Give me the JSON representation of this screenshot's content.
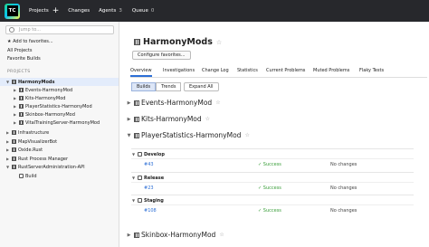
{
  "topbar": {
    "logo": "TC",
    "projects_label": "Projects",
    "changes_label": "Changes",
    "agents_label": "Agents",
    "agents_count": "3",
    "queue_label": "Queue",
    "queue_count": "0"
  },
  "sidebar": {
    "search_placeholder": "Jump to...",
    "add_favorites": "★ Add to favorites...",
    "all_projects": "All Projects",
    "favorite_builds": "Favorite Builds",
    "section_title": "PROJECTS",
    "tree": [
      {
        "label": "HarmonyMods",
        "level": 0,
        "icon": "project-icon",
        "selected": true,
        "expanded": true
      },
      {
        "label": "Events-HarmonyMod",
        "level": 1,
        "icon": "project-icon"
      },
      {
        "label": "Kits-HarmonyMod",
        "level": 1,
        "icon": "project-icon"
      },
      {
        "label": "PlayerStatistics-HarmonyMod",
        "level": 1,
        "icon": "project-icon"
      },
      {
        "label": "Skinbox-HarmonyMod",
        "level": 1,
        "icon": "project-icon"
      },
      {
        "label": "VitalTrainingServer-HarmonyMod",
        "level": 1,
        "icon": "project-icon"
      },
      {
        "label": "Infrastructure",
        "level": 0,
        "icon": "project-icon"
      },
      {
        "label": "MapVisualizerBot",
        "level": 0,
        "icon": "project-icon"
      },
      {
        "label": "Oxide.Rust",
        "level": 0,
        "icon": "project-icon"
      },
      {
        "label": "Rust Process Manager",
        "level": 0,
        "icon": "project-icon"
      },
      {
        "label": "RustServerAdministration-API",
        "level": 0,
        "icon": "project-icon",
        "expanded": true
      },
      {
        "label": "Build",
        "level": 1,
        "icon": "config-icon"
      }
    ]
  },
  "main": {
    "title": "HarmonyMods",
    "configure_favorites": "Configure favorites...",
    "tabs": [
      "Overview",
      "Investigations",
      "Change Log",
      "Statistics",
      "Current Problems",
      "Muted Problems",
      "Flaky Tests"
    ],
    "active_tab": "Overview",
    "view_toggle": [
      "Builds",
      "Trends"
    ],
    "active_view": "Builds",
    "expand_all": "Expand All",
    "subprojects": [
      {
        "name": "Events-HarmonyMod",
        "expanded": false
      },
      {
        "name": "Kits-HarmonyMod",
        "expanded": false
      },
      {
        "name": "PlayerStatistics-HarmonyMod",
        "expanded": true,
        "configs": [
          {
            "name": "Develop",
            "build": "#43",
            "status": "Success",
            "changes": "No changes"
          },
          {
            "name": "Release",
            "build": "#23",
            "status": "Success",
            "changes": "No changes"
          },
          {
            "name": "Staging",
            "build": "#108",
            "status": "Success",
            "changes": "No changes"
          }
        ]
      },
      {
        "name": "Skinbox-HarmonyMod",
        "expanded": false
      }
    ]
  },
  "colors": {
    "accent": "#2d6fd6",
    "success": "#3a9e3a",
    "topbar": "#27282c"
  }
}
